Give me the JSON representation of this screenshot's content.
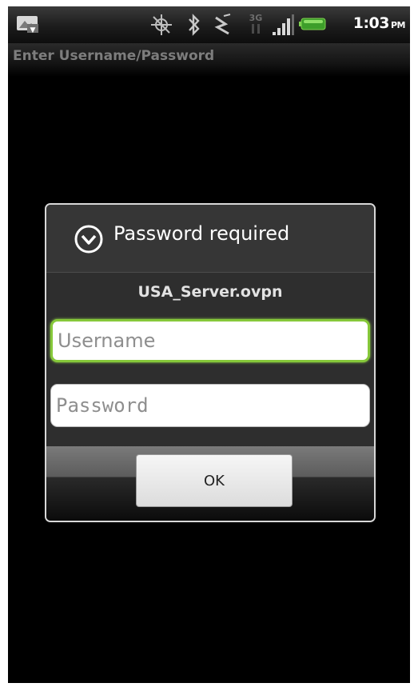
{
  "status_bar": {
    "icons": [
      "notification-image-icon",
      "gps-icon",
      "bluetooth-icon",
      "vibrate-icon",
      "3g-icon",
      "signal-icon",
      "battery-icon"
    ],
    "time": "1:03",
    "ampm": "PM"
  },
  "title_bar": {
    "title": "Enter Username/Password"
  },
  "dialog": {
    "title": "Password required",
    "subtitle": "USA_Server.ovpn",
    "username": {
      "placeholder": "Username",
      "value": ""
    },
    "password": {
      "placeholder": "Password",
      "value": ""
    },
    "ok_label": "OK"
  },
  "colors": {
    "focus_green": "#86c83a",
    "screen_bg": "#000000",
    "dialog_bg": "#2e2e2e"
  }
}
